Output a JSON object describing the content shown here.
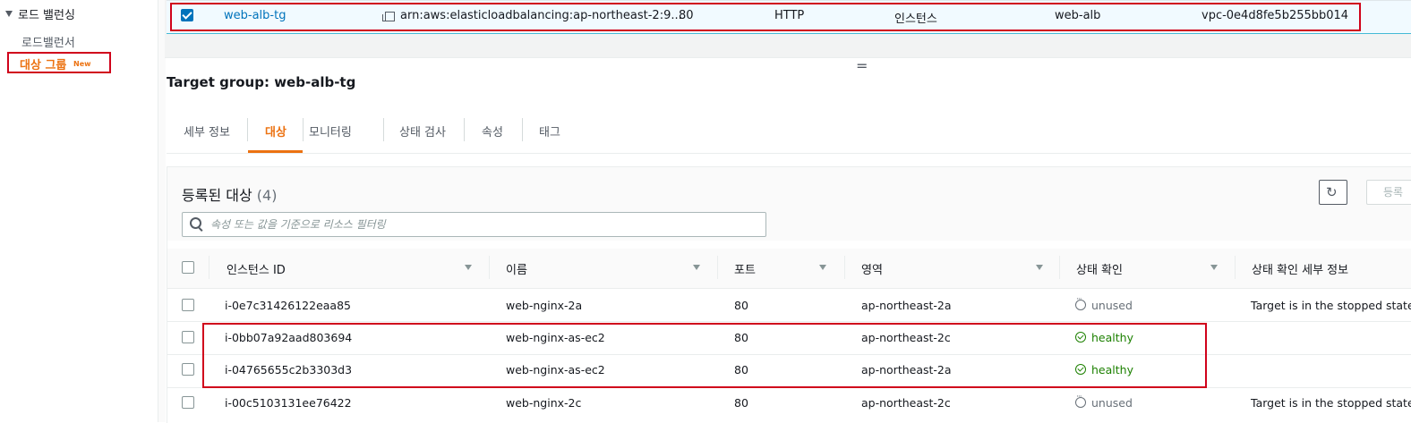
{
  "sidebar": {
    "heading": "로드 밸런싱",
    "items": [
      {
        "label": "로드밸런서"
      },
      {
        "label": "대상 그룹",
        "badge": "New",
        "active": true
      }
    ]
  },
  "selected_row": {
    "name": "web-alb-tg",
    "arn": "arn:aws:elasticloadbalancing:ap-northeast-2:9...",
    "port": "80",
    "protocol": "HTTP",
    "target_type": "인스턴스",
    "load_balancer": "web-alb",
    "vpc": "vpc-0e4d8fe5b255bb014"
  },
  "resizer": "=",
  "title": "Target group: web-alb-tg",
  "tabs": [
    {
      "label": "세부 정보"
    },
    {
      "label": "대상",
      "active": true
    },
    {
      "label": "모니터링"
    },
    {
      "label": "상태 검사"
    },
    {
      "label": "속성"
    },
    {
      "label": "태그"
    }
  ],
  "registered": {
    "title": "등록된 대상",
    "count": "(4)",
    "register_button": "등록",
    "search_placeholder": "속성 또는 값을 기준으로 리소스 필터링"
  },
  "columns": [
    "인스턴스 ID",
    "이름",
    "포트",
    "영역",
    "상태 확인",
    "상태 확인 세부 정보"
  ],
  "rows": [
    {
      "id": "i-0e7c31426122eaa85",
      "name": "web-nginx-2a",
      "port": "80",
      "zone": "ap-northeast-2a",
      "health": "unused",
      "details": "Target is in the stopped state"
    },
    {
      "id": "i-0bb07a92aad803694",
      "name": "web-nginx-as-ec2",
      "port": "80",
      "zone": "ap-northeast-2c",
      "health": "healthy",
      "details": ""
    },
    {
      "id": "i-04765655c2b3303d3",
      "name": "web-nginx-as-ec2",
      "port": "80",
      "zone": "ap-northeast-2a",
      "health": "healthy",
      "details": ""
    },
    {
      "id": "i-00c5103131ee76422",
      "name": "web-nginx-2c",
      "port": "80",
      "zone": "ap-northeast-2c",
      "health": "unused",
      "details": "Target is in the stopped state"
    }
  ],
  "colors": {
    "accent": "#ec7211",
    "link": "#0073bb",
    "healthy": "#1d8102",
    "highlight": "#d0021b"
  }
}
